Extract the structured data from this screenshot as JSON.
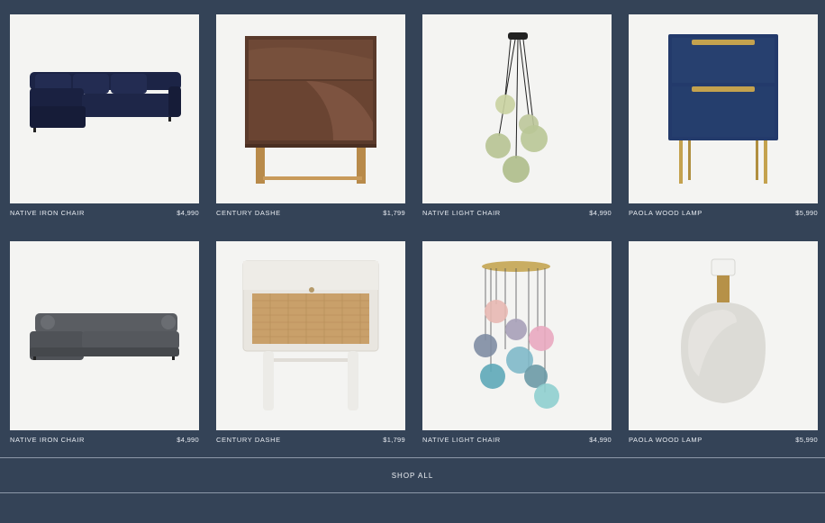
{
  "products": [
    {
      "name": "NATIVE IRON CHAIR",
      "price": "$4,990",
      "icon": "navy-sectional-sofa-image"
    },
    {
      "name": "CENTURY DASHE",
      "price": "$1,799",
      "icon": "walnut-nightstand-image"
    },
    {
      "name": "NATIVE LIGHT CHAIR",
      "price": "$4,990",
      "icon": "green-glass-pendant-light-image"
    },
    {
      "name": "PAOLA WOOD LAMP",
      "price": "$5,990",
      "icon": "navy-brass-nightstand-image"
    },
    {
      "name": "NATIVE IRON CHAIR",
      "price": "$4,990",
      "icon": "grey-sectional-sofa-image"
    },
    {
      "name": "CENTURY DASHE",
      "price": "$1,799",
      "icon": "white-rattan-nightstand-image"
    },
    {
      "name": "NATIVE LIGHT CHAIR",
      "price": "$4,990",
      "icon": "multicolor-glass-chandelier-image"
    },
    {
      "name": "PAOLA WOOD LAMP",
      "price": "$5,990",
      "icon": "stone-table-lamp-image"
    }
  ],
  "shop_all_label": "SHOP ALL",
  "colors": {
    "background": "#344357",
    "image_background": "#f4f4f2",
    "divider": "#8c98a8"
  }
}
